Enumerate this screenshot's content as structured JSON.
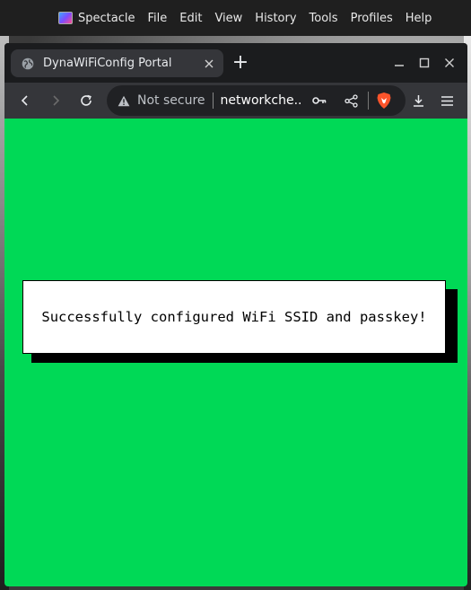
{
  "menubar": {
    "app_name": "Spectacle",
    "items": [
      "File",
      "Edit",
      "View",
      "History",
      "Tools",
      "Profiles",
      "Help"
    ]
  },
  "browser": {
    "tab": {
      "title": "DynaWiFiConfig Portal",
      "close_icon": "close-icon",
      "favicon": "globe-icon"
    },
    "new_tab_label": "+",
    "address_bar": {
      "security_label": "Not secure",
      "url_text": "networkche..."
    }
  },
  "page": {
    "background_color": "#00d956",
    "message": "Successfully configured WiFi SSID and passkey!"
  },
  "colors": {
    "chrome_dark": "#1b1c1e",
    "toolbar": "#35363a",
    "brave_orange": "#fb542b"
  }
}
